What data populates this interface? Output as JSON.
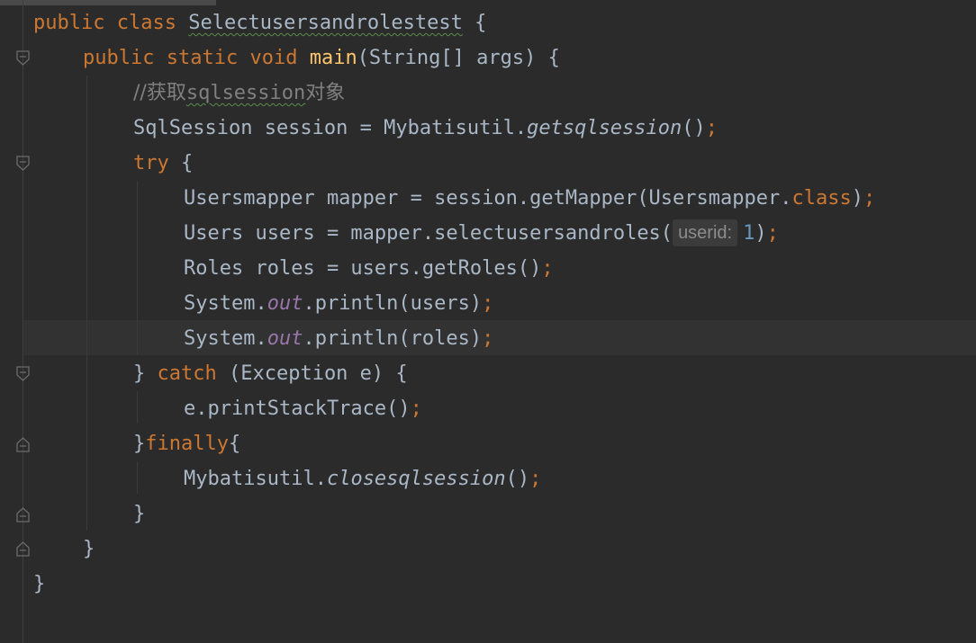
{
  "code": {
    "l1": {
      "kw_public": "public",
      "kw_class": "class",
      "class_name": "Selectusersandrolestest",
      "brace": "{"
    },
    "l2": {
      "kw_public": "public",
      "kw_static": "static",
      "kw_void": "void",
      "method": "main",
      "params": "(String[] args) {"
    },
    "l3": {
      "comment_prefix": "//获取",
      "comment_word": "sqlsession",
      "comment_suffix": "对象"
    },
    "l4": {
      "pre": "SqlSession session = Mybatisutil.",
      "method": "getsqlsession",
      "post": "()",
      "semi": ";"
    },
    "l5": {
      "kw_try": "try",
      "brace": "{"
    },
    "l6": {
      "pre": "Usersmapper mapper = session.getMapper(Usersmapper.",
      "kw_class": "class",
      "post": ")",
      "semi": ";"
    },
    "l7": {
      "pre": "Users users = mapper.selectusersandroles(",
      "hint": "userid:",
      "num": "1",
      "post": ")",
      "semi": ";"
    },
    "l8": {
      "pre": "Roles roles = users.getRoles()",
      "semi": ";"
    },
    "l9": {
      "pre": "System.",
      "field": "out",
      "post": ".println(users)",
      "semi": ";"
    },
    "l10": {
      "pre": "System.",
      "field": "out",
      "post": ".println(roles)",
      "semi": ";"
    },
    "l11": {
      "pre": "} ",
      "kw_catch": "catch",
      "post": " (Exception e) {"
    },
    "l12": {
      "pre": "e.printStackTrace()",
      "semi": ";"
    },
    "l13": {
      "pre": "}",
      "kw_finally": "finally",
      "post": "{"
    },
    "l14": {
      "pre": "Mybatisutil.",
      "method": "closesqlsession",
      "post": "()",
      "semi": ";"
    },
    "l15": {
      "brace": "}"
    },
    "l16": {
      "brace": "}"
    },
    "l17": {
      "brace": "}"
    }
  },
  "theme": {
    "background": "#2b2b2b",
    "keyword": "#cc7832",
    "method_decl": "#ffc66d",
    "comment": "#808080",
    "number": "#6897bb",
    "field": "#9876aa",
    "text": "#a9b7c6"
  }
}
